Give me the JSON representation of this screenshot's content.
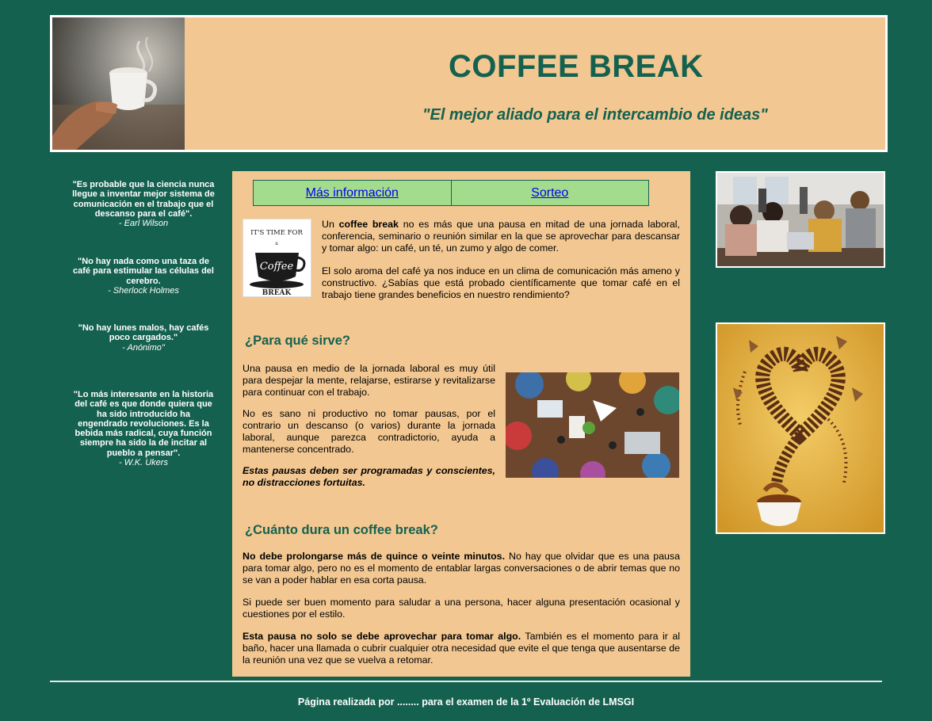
{
  "header": {
    "title": "COFFEE BREAK",
    "subtitle": "\"El mejor aliado para el intercambio de ideas\""
  },
  "quotes": [
    {
      "text": "\"Es probable que la ciencia nunca llegue a inventar mejor sistema de comunicación en el trabajo que el descanso para el café\".",
      "author": "- Earl Wilson"
    },
    {
      "text": "\"No hay nada como una taza de café para estimular las células del cerebro.",
      "author": "- Sherlock Holmes"
    },
    {
      "text": "\"No hay lunes malos, hay cafés poco cargados.\"",
      "author": "- Anónimo\""
    },
    {
      "text": "\"Lo más interesante en la historia del café es que donde quiera que ha sido introducido ha engendrado revoluciones. Es la bebida más radical, cuya función siempre ha sido la de incitar al pueblo a pensar\".",
      "author": "- W.K. Ukers"
    }
  ],
  "nav": {
    "links": [
      "Más información",
      "Sorteo"
    ]
  },
  "logo": {
    "line1": "IT'S TIME FOR",
    "line2": "a",
    "line3": "Coffee",
    "line4": "BREAK"
  },
  "intro": {
    "p1_before": "Un ",
    "p1_bold": "coffee break",
    "p1_after": " no es más que una pausa en mitad de una jornada laboral, conferencia, seminario o reunión similar en la que se aprovechar para descansar y tomar algo: un café, un té, un zumo y algo de comer.",
    "p2": "El solo aroma del café ya nos induce en un clima de comunicación más ameno y constructivo. ¿Sabías que está probado científicamente que tomar café en el trabajo tiene grandes beneficios en nuestro rendimiento?"
  },
  "section1": {
    "title": "¿Para qué sirve?",
    "p1": "Una pausa en medio de la jornada laboral es muy útil para despejar la mente, relajarse, estirarse y revitalizarse para continuar con el trabajo.",
    "p2": "No es sano ni productivo no tomar pausas, por el contrario un descanso (o varios) durante la jornada laboral, aunque parezca contradictorio, ayuda a mantenerse concentrado.",
    "p3": "Estas pausas deben ser programadas y conscientes, no distracciones fortuitas."
  },
  "section2": {
    "title": "¿Cuánto dura un coffee break?",
    "p1_bold": "No debe prolongarse más de quince o veinte minutos.",
    "p1_rest": " No hay que olvidar que es una pausa para tomar algo, pero no es el momento de entablar largas conversaciones o de abrir temas que no se van a poder hablar en esa corta pausa.",
    "p2": "Si puede ser buen momento para saludar a una persona, hacer alguna presentación ocasional y cuestiones por el estilo.",
    "p3_bold": "Esta pausa no solo se debe aprovechar para tomar algo.",
    "p3_rest": " También es el momento para ir al baño, hacer una llamada o cubrir cualquier otra necesidad que evite el que tenga que ausentarse de la reunión una vez que se vuelva a retomar."
  },
  "footer": {
    "text": "Página realizada por ........ para el examen de la 1º Evaluación de LMSGI"
  },
  "colors": {
    "background": "#15614f",
    "panel": "#f2c791",
    "nav_bg": "#a4dc8e",
    "accent_text": "#15614f"
  }
}
